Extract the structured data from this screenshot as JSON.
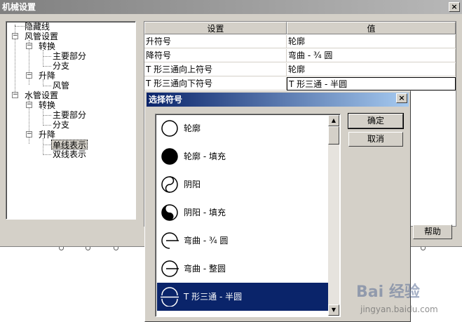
{
  "window": {
    "title": "机械设置",
    "close_glyph": "×"
  },
  "tree": [
    {
      "label": "隐藏线"
    },
    {
      "label": "风管设置",
      "toggle": "−"
    },
    {
      "label": "转换",
      "toggle": "−"
    },
    {
      "label": "主要部分"
    },
    {
      "label": "分支"
    },
    {
      "label": "升降",
      "toggle": "−"
    },
    {
      "label": "风管"
    },
    {
      "label": "水管设置",
      "toggle": "−"
    },
    {
      "label": "转换",
      "toggle": "−"
    },
    {
      "label": "主要部分"
    },
    {
      "label": "分支"
    },
    {
      "label": "升降",
      "toggle": "−"
    },
    {
      "label": "单线表示"
    },
    {
      "label": "双线表示"
    }
  ],
  "grid": {
    "headers": [
      "设置",
      "值"
    ],
    "rows": [
      [
        "升符号",
        "轮廓"
      ],
      [
        "降符号",
        "弯曲 - ¾ 圆"
      ],
      [
        "T 形三通向上符号",
        "轮廓"
      ],
      [
        "T 形三通向下符号",
        "T 形三通 - 半圆"
      ]
    ]
  },
  "help_label": "帮助",
  "dialog": {
    "title": "选择符号",
    "close_glyph": "×",
    "ok_label": "确定",
    "cancel_label": "取消",
    "scroll_up": "▲",
    "scroll_down": "▼",
    "items": [
      {
        "label": "轮廓",
        "icon": "circle-outline-icon"
      },
      {
        "label": "轮廓 - 填充",
        "icon": "circle-filled-icon"
      },
      {
        "label": "阴阳",
        "icon": "yin-yang-icon"
      },
      {
        "label": "阴阳 - 填充",
        "icon": "yin-yang-filled-icon"
      },
      {
        "label": "弯曲 - ¾ 圆",
        "icon": "bend-three-quarter-icon"
      },
      {
        "label": "弯曲 - 整圆",
        "icon": "bend-full-circle-icon"
      },
      {
        "label": "T 形三通 - 半圆",
        "icon": "tee-half-circle-icon",
        "selected": true
      }
    ]
  },
  "watermark": {
    "logo": "Bai 经验",
    "url": "jingyan.baidu.com"
  },
  "colors": {
    "title_active": "#0a246a",
    "title_inactive": "#808080",
    "face": "#d4d0c8",
    "selection": "#0a246a"
  }
}
